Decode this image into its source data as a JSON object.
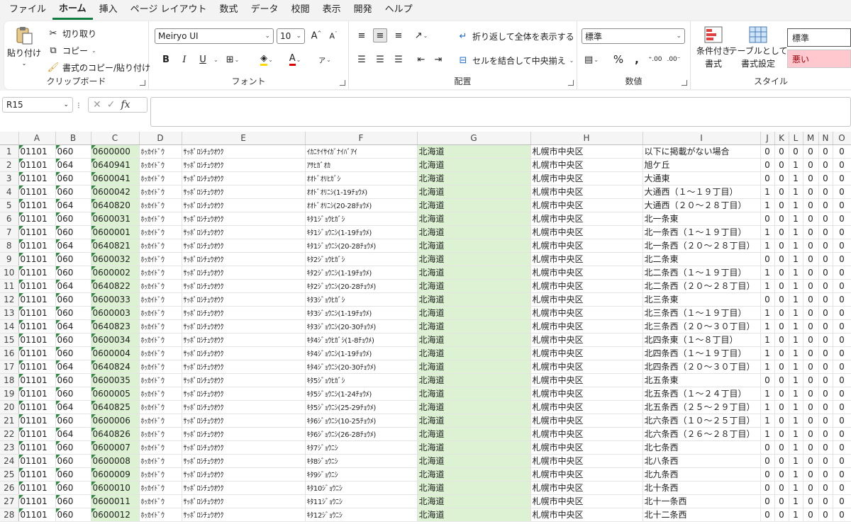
{
  "menu": [
    "ファイル",
    "ホーム",
    "挿入",
    "ページ レイアウト",
    "数式",
    "データ",
    "校閲",
    "表示",
    "開発",
    "ヘルプ"
  ],
  "menu_active_index": 1,
  "clipboard": {
    "paste": "貼り付け",
    "cut": "切り取り",
    "copy": "コピー",
    "format_painter": "書式のコピー/貼り付け",
    "label": "クリップボード"
  },
  "font": {
    "name": "Meiryo UI",
    "size": "10",
    "bold": "B",
    "italic": "I",
    "underline": "U",
    "label": "フォント"
  },
  "alignment": {
    "wrap": "折り返して全体を表示する",
    "merge": "セルを結合して中央揃え",
    "label": "配置"
  },
  "number": {
    "format": "標準",
    "label": "数値"
  },
  "styles": {
    "conditional": [
      "条件付き",
      "書式"
    ],
    "table": [
      "テーブルとして",
      "書式設定"
    ],
    "normal": "標準",
    "bad": "悪い",
    "label": "スタイル"
  },
  "formula_bar": {
    "cell_ref": "R15",
    "fx": "fx",
    "value": ""
  },
  "colors": {
    "accent": "#107c41",
    "green_fill": "#dcf2d3",
    "bad_fill": "#ffc7ce",
    "bad_text": "#9c0006"
  },
  "columns": [
    "A",
    "B",
    "C",
    "D",
    "E",
    "F",
    "G",
    "H",
    "I",
    "J",
    "K",
    "L",
    "M",
    "N",
    "O"
  ],
  "rows": [
    {
      "n": "1",
      "a": "01101",
      "b": "060",
      "c": "0600000",
      "d": "ﾎｯｶｲﾄﾞｳ",
      "e": "ｻｯﾎﾟﾛｼﾁｭｳｵｳｸ",
      "f": "ｲｶﾆｹｲｻｲｶﾞﾅｲﾊﾞｱｲ",
      "g": "北海道",
      "h": "札幌市中央区",
      "i": "以下に掲載がない場合",
      "j": "0",
      "k": "0",
      "l": "0",
      "m": "0",
      "nn": "0",
      "o": "0"
    },
    {
      "n": "2",
      "a": "01101",
      "b": "064",
      "c": "0640941",
      "d": "ﾎｯｶｲﾄﾞｳ",
      "e": "ｻｯﾎﾟﾛｼﾁｭｳｵｳｸ",
      "f": "ｱｻﾋｶﾞｵｶ",
      "g": "北海道",
      "h": "札幌市中央区",
      "i": "旭ケ丘",
      "j": "0",
      "k": "0",
      "l": "1",
      "m": "0",
      "nn": "0",
      "o": "0"
    },
    {
      "n": "3",
      "a": "01101",
      "b": "060",
      "c": "0600041",
      "d": "ﾎｯｶｲﾄﾞｳ",
      "e": "ｻｯﾎﾟﾛｼﾁｭｳｵｳｸ",
      "f": "ｵｵﾄﾞｵﾘﾋｶﾞｼ",
      "g": "北海道",
      "h": "札幌市中央区",
      "i": "大通東",
      "j": "0",
      "k": "0",
      "l": "1",
      "m": "0",
      "nn": "0",
      "o": "0"
    },
    {
      "n": "4",
      "a": "01101",
      "b": "060",
      "c": "0600042",
      "d": "ﾎｯｶｲﾄﾞｳ",
      "e": "ｻｯﾎﾟﾛｼﾁｭｳｵｳｸ",
      "f": "ｵｵﾄﾞｵﾘﾆｼ(1-19ﾁｮｳﾒ)",
      "g": "北海道",
      "h": "札幌市中央区",
      "i": "大通西（１～１９丁目）",
      "j": "1",
      "k": "0",
      "l": "1",
      "m": "0",
      "nn": "0",
      "o": "0"
    },
    {
      "n": "5",
      "a": "01101",
      "b": "064",
      "c": "0640820",
      "d": "ﾎｯｶｲﾄﾞｳ",
      "e": "ｻｯﾎﾟﾛｼﾁｭｳｵｳｸ",
      "f": "ｵｵﾄﾞｵﾘﾆｼ(20-28ﾁｮｳﾒ)",
      "g": "北海道",
      "h": "札幌市中央区",
      "i": "大通西（２０～２８丁目）",
      "j": "1",
      "k": "0",
      "l": "1",
      "m": "0",
      "nn": "0",
      "o": "0"
    },
    {
      "n": "6",
      "a": "01101",
      "b": "060",
      "c": "0600031",
      "d": "ﾎｯｶｲﾄﾞｳ",
      "e": "ｻｯﾎﾟﾛｼﾁｭｳｵｳｸ",
      "f": "ｷﾀ1ｼﾞｮｳﾋｶﾞｼ",
      "g": "北海道",
      "h": "札幌市中央区",
      "i": "北一条東",
      "j": "0",
      "k": "0",
      "l": "1",
      "m": "0",
      "nn": "0",
      "o": "0"
    },
    {
      "n": "7",
      "a": "01101",
      "b": "060",
      "c": "0600001",
      "d": "ﾎｯｶｲﾄﾞｳ",
      "e": "ｻｯﾎﾟﾛｼﾁｭｳｵｳｸ",
      "f": "ｷﾀ1ｼﾞｮｳﾆｼ(1-19ﾁｮｳﾒ)",
      "g": "北海道",
      "h": "札幌市中央区",
      "i": "北一条西（１～１９丁目）",
      "j": "1",
      "k": "0",
      "l": "1",
      "m": "0",
      "nn": "0",
      "o": "0"
    },
    {
      "n": "8",
      "a": "01101",
      "b": "064",
      "c": "0640821",
      "d": "ﾎｯｶｲﾄﾞｳ",
      "e": "ｻｯﾎﾟﾛｼﾁｭｳｵｳｸ",
      "f": "ｷﾀ1ｼﾞｮｳﾆｼ(20-28ﾁｮｳﾒ)",
      "g": "北海道",
      "h": "札幌市中央区",
      "i": "北一条西（２０～２８丁目）",
      "j": "1",
      "k": "0",
      "l": "1",
      "m": "0",
      "nn": "0",
      "o": "0"
    },
    {
      "n": "9",
      "a": "01101",
      "b": "060",
      "c": "0600032",
      "d": "ﾎｯｶｲﾄﾞｳ",
      "e": "ｻｯﾎﾟﾛｼﾁｭｳｵｳｸ",
      "f": "ｷﾀ2ｼﾞｮｳﾋｶﾞｼ",
      "g": "北海道",
      "h": "札幌市中央区",
      "i": "北二条東",
      "j": "0",
      "k": "0",
      "l": "1",
      "m": "0",
      "nn": "0",
      "o": "0"
    },
    {
      "n": "10",
      "a": "01101",
      "b": "060",
      "c": "0600002",
      "d": "ﾎｯｶｲﾄﾞｳ",
      "e": "ｻｯﾎﾟﾛｼﾁｭｳｵｳｸ",
      "f": "ｷﾀ2ｼﾞｮｳﾆｼ(1-19ﾁｮｳﾒ)",
      "g": "北海道",
      "h": "札幌市中央区",
      "i": "北二条西（１～１９丁目）",
      "j": "1",
      "k": "0",
      "l": "1",
      "m": "0",
      "nn": "0",
      "o": "0"
    },
    {
      "n": "11",
      "a": "01101",
      "b": "064",
      "c": "0640822",
      "d": "ﾎｯｶｲﾄﾞｳ",
      "e": "ｻｯﾎﾟﾛｼﾁｭｳｵｳｸ",
      "f": "ｷﾀ2ｼﾞｮｳﾆｼ(20-28ﾁｮｳﾒ)",
      "g": "北海道",
      "h": "札幌市中央区",
      "i": "北二条西（２０～２８丁目）",
      "j": "1",
      "k": "0",
      "l": "1",
      "m": "0",
      "nn": "0",
      "o": "0"
    },
    {
      "n": "12",
      "a": "01101",
      "b": "060",
      "c": "0600033",
      "d": "ﾎｯｶｲﾄﾞｳ",
      "e": "ｻｯﾎﾟﾛｼﾁｭｳｵｳｸ",
      "f": "ｷﾀ3ｼﾞｮｳﾋｶﾞｼ",
      "g": "北海道",
      "h": "札幌市中央区",
      "i": "北三条東",
      "j": "0",
      "k": "0",
      "l": "1",
      "m": "0",
      "nn": "0",
      "o": "0"
    },
    {
      "n": "13",
      "a": "01101",
      "b": "060",
      "c": "0600003",
      "d": "ﾎｯｶｲﾄﾞｳ",
      "e": "ｻｯﾎﾟﾛｼﾁｭｳｵｳｸ",
      "f": "ｷﾀ3ｼﾞｮｳﾆｼ(1-19ﾁｮｳﾒ)",
      "g": "北海道",
      "h": "札幌市中央区",
      "i": "北三条西（１～１９丁目）",
      "j": "1",
      "k": "0",
      "l": "1",
      "m": "0",
      "nn": "0",
      "o": "0"
    },
    {
      "n": "14",
      "a": "01101",
      "b": "064",
      "c": "0640823",
      "d": "ﾎｯｶｲﾄﾞｳ",
      "e": "ｻｯﾎﾟﾛｼﾁｭｳｵｳｸ",
      "f": "ｷﾀ3ｼﾞｮｳﾆｼ(20-30ﾁｮｳﾒ)",
      "g": "北海道",
      "h": "札幌市中央区",
      "i": "北三条西（２０～３０丁目）",
      "j": "1",
      "k": "0",
      "l": "1",
      "m": "0",
      "nn": "0",
      "o": "0"
    },
    {
      "n": "15",
      "a": "01101",
      "b": "060",
      "c": "0600034",
      "d": "ﾎｯｶｲﾄﾞｳ",
      "e": "ｻｯﾎﾟﾛｼﾁｭｳｵｳｸ",
      "f": "ｷﾀ4ｼﾞｮｳﾋｶﾞｼ(1-8ﾁｮｳﾒ)",
      "g": "北海道",
      "h": "札幌市中央区",
      "i": "北四条東（１～８丁目）",
      "j": "1",
      "k": "0",
      "l": "1",
      "m": "0",
      "nn": "0",
      "o": "0"
    },
    {
      "n": "16",
      "a": "01101",
      "b": "060",
      "c": "0600004",
      "d": "ﾎｯｶｲﾄﾞｳ",
      "e": "ｻｯﾎﾟﾛｼﾁｭｳｵｳｸ",
      "f": "ｷﾀ4ｼﾞｮｳﾆｼ(1-19ﾁｮｳﾒ)",
      "g": "北海道",
      "h": "札幌市中央区",
      "i": "北四条西（１～１９丁目）",
      "j": "1",
      "k": "0",
      "l": "1",
      "m": "0",
      "nn": "0",
      "o": "0"
    },
    {
      "n": "17",
      "a": "01101",
      "b": "064",
      "c": "0640824",
      "d": "ﾎｯｶｲﾄﾞｳ",
      "e": "ｻｯﾎﾟﾛｼﾁｭｳｵｳｸ",
      "f": "ｷﾀ4ｼﾞｮｳﾆｼ(20-30ﾁｮｳﾒ)",
      "g": "北海道",
      "h": "札幌市中央区",
      "i": "北四条西（２０～３０丁目）",
      "j": "1",
      "k": "0",
      "l": "1",
      "m": "0",
      "nn": "0",
      "o": "0"
    },
    {
      "n": "18",
      "a": "01101",
      "b": "060",
      "c": "0600035",
      "d": "ﾎｯｶｲﾄﾞｳ",
      "e": "ｻｯﾎﾟﾛｼﾁｭｳｵｳｸ",
      "f": "ｷﾀ5ｼﾞｮｳﾋｶﾞｼ",
      "g": "北海道",
      "h": "札幌市中央区",
      "i": "北五条東",
      "j": "0",
      "k": "0",
      "l": "1",
      "m": "0",
      "nn": "0",
      "o": "0"
    },
    {
      "n": "19",
      "a": "01101",
      "b": "060",
      "c": "0600005",
      "d": "ﾎｯｶｲﾄﾞｳ",
      "e": "ｻｯﾎﾟﾛｼﾁｭｳｵｳｸ",
      "f": "ｷﾀ5ｼﾞｮｳﾆｼ(1-24ﾁｮｳﾒ)",
      "g": "北海道",
      "h": "札幌市中央区",
      "i": "北五条西（１～２４丁目）",
      "j": "1",
      "k": "0",
      "l": "1",
      "m": "0",
      "nn": "0",
      "o": "0"
    },
    {
      "n": "20",
      "a": "01101",
      "b": "064",
      "c": "0640825",
      "d": "ﾎｯｶｲﾄﾞｳ",
      "e": "ｻｯﾎﾟﾛｼﾁｭｳｵｳｸ",
      "f": "ｷﾀ5ｼﾞｮｳﾆｼ(25-29ﾁｮｳﾒ)",
      "g": "北海道",
      "h": "札幌市中央区",
      "i": "北五条西（２５～２９丁目）",
      "j": "1",
      "k": "0",
      "l": "1",
      "m": "0",
      "nn": "0",
      "o": "0"
    },
    {
      "n": "21",
      "a": "01101",
      "b": "060",
      "c": "0600006",
      "d": "ﾎｯｶｲﾄﾞｳ",
      "e": "ｻｯﾎﾟﾛｼﾁｭｳｵｳｸ",
      "f": "ｷﾀ6ｼﾞｮｳﾆｼ(10-25ﾁｮｳﾒ)",
      "g": "北海道",
      "h": "札幌市中央区",
      "i": "北六条西（１０～２５丁目）",
      "j": "1",
      "k": "0",
      "l": "1",
      "m": "0",
      "nn": "0",
      "o": "0"
    },
    {
      "n": "22",
      "a": "01101",
      "b": "064",
      "c": "0640826",
      "d": "ﾎｯｶｲﾄﾞｳ",
      "e": "ｻｯﾎﾟﾛｼﾁｭｳｵｳｸ",
      "f": "ｷﾀ6ｼﾞｮｳﾆｼ(26-28ﾁｮｳﾒ)",
      "g": "北海道",
      "h": "札幌市中央区",
      "i": "北六条西（２６～２８丁目）",
      "j": "1",
      "k": "0",
      "l": "1",
      "m": "0",
      "nn": "0",
      "o": "0"
    },
    {
      "n": "23",
      "a": "01101",
      "b": "060",
      "c": "0600007",
      "d": "ﾎｯｶｲﾄﾞｳ",
      "e": "ｻｯﾎﾟﾛｼﾁｭｳｵｳｸ",
      "f": "ｷﾀ7ｼﾞｮｳﾆｼ",
      "g": "北海道",
      "h": "札幌市中央区",
      "i": "北七条西",
      "j": "0",
      "k": "0",
      "l": "1",
      "m": "0",
      "nn": "0",
      "o": "0"
    },
    {
      "n": "24",
      "a": "01101",
      "b": "060",
      "c": "0600008",
      "d": "ﾎｯｶｲﾄﾞｳ",
      "e": "ｻｯﾎﾟﾛｼﾁｭｳｵｳｸ",
      "f": "ｷﾀ8ｼﾞｮｳﾆｼ",
      "g": "北海道",
      "h": "札幌市中央区",
      "i": "北八条西",
      "j": "0",
      "k": "0",
      "l": "1",
      "m": "0",
      "nn": "0",
      "o": "0"
    },
    {
      "n": "25",
      "a": "01101",
      "b": "060",
      "c": "0600009",
      "d": "ﾎｯｶｲﾄﾞｳ",
      "e": "ｻｯﾎﾟﾛｼﾁｭｳｵｳｸ",
      "f": "ｷﾀ9ｼﾞｮｳﾆｼ",
      "g": "北海道",
      "h": "札幌市中央区",
      "i": "北九条西",
      "j": "0",
      "k": "0",
      "l": "1",
      "m": "0",
      "nn": "0",
      "o": "0"
    },
    {
      "n": "26",
      "a": "01101",
      "b": "060",
      "c": "0600010",
      "d": "ﾎｯｶｲﾄﾞｳ",
      "e": "ｻｯﾎﾟﾛｼﾁｭｳｵｳｸ",
      "f": "ｷﾀ10ｼﾞｮｳﾆｼ",
      "g": "北海道",
      "h": "札幌市中央区",
      "i": "北十条西",
      "j": "0",
      "k": "0",
      "l": "1",
      "m": "0",
      "nn": "0",
      "o": "0"
    },
    {
      "n": "27",
      "a": "01101",
      "b": "060",
      "c": "0600011",
      "d": "ﾎｯｶｲﾄﾞｳ",
      "e": "ｻｯﾎﾟﾛｼﾁｭｳｵｳｸ",
      "f": "ｷﾀ11ｼﾞｮｳﾆｼ",
      "g": "北海道",
      "h": "札幌市中央区",
      "i": "北十一条西",
      "j": "0",
      "k": "0",
      "l": "1",
      "m": "0",
      "nn": "0",
      "o": "0"
    },
    {
      "n": "28",
      "a": "01101",
      "b": "060",
      "c": "0600012",
      "d": "ﾎｯｶｲﾄﾞｳ",
      "e": "ｻｯﾎﾟﾛｼﾁｭｳｵｳｸ",
      "f": "ｷﾀ12ｼﾞｮｳﾆｼ",
      "g": "北海道",
      "h": "札幌市中央区",
      "i": "北十二条西",
      "j": "0",
      "k": "0",
      "l": "1",
      "m": "0",
      "nn": "0",
      "o": "0"
    }
  ]
}
